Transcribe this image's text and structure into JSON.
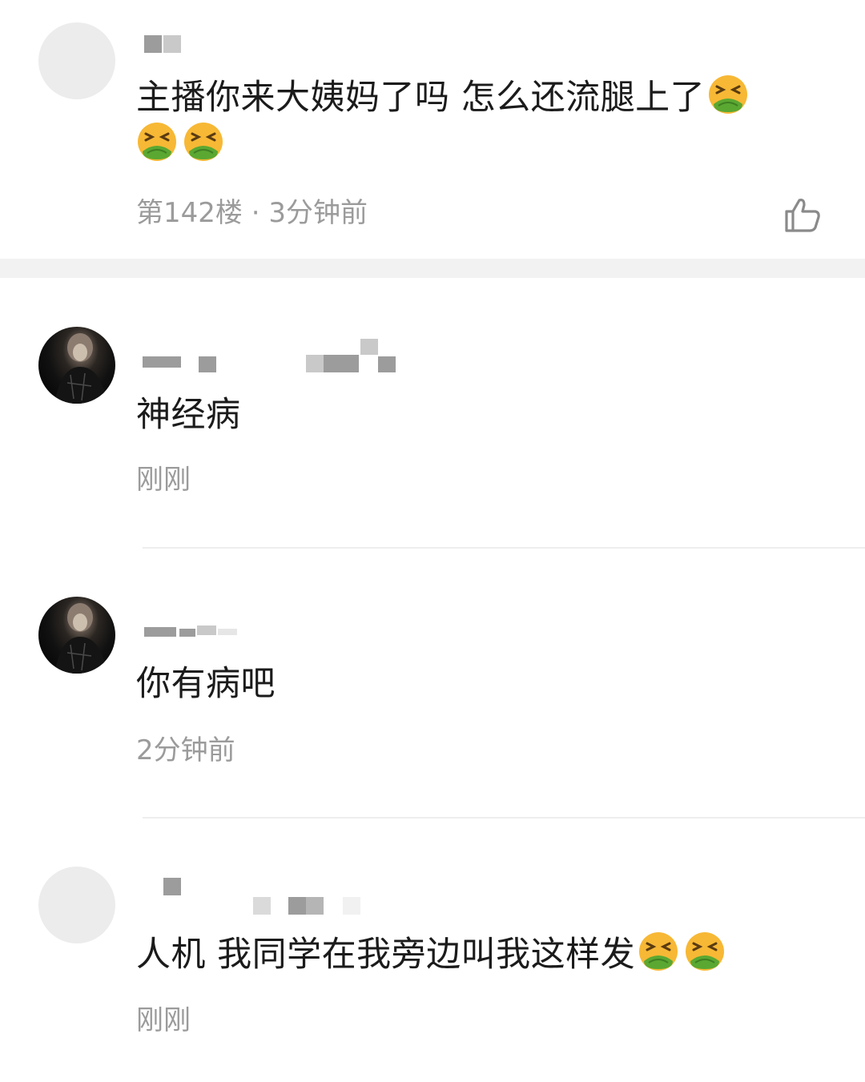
{
  "comments": [
    {
      "text": "主播你来大姨妈了吗 怎么还流腿上了",
      "emoji_after": [
        "nauseated-face",
        "nauseated-face",
        "nauseated-face"
      ],
      "meta": "第142楼 · 3分钟前"
    },
    {
      "text": "神经病",
      "meta": "刚刚"
    },
    {
      "text": "你有病吧",
      "meta": "2分钟前"
    },
    {
      "text": "人机 我同学在我旁边叫我这样发",
      "emoji_after": [
        "nauseated-face",
        "nauseated-face"
      ],
      "meta": "刚刚"
    }
  ],
  "icons": {
    "like": "thumbs-up-icon",
    "emoji": "nauseated-face"
  },
  "colors": {
    "text": "#1b1b1b",
    "meta": "#9b9b9b",
    "divider": "#eeeeee",
    "section_band": "#f2f2f2",
    "emoji_face": "#f7b835",
    "emoji_vomit": "#5aa832"
  }
}
